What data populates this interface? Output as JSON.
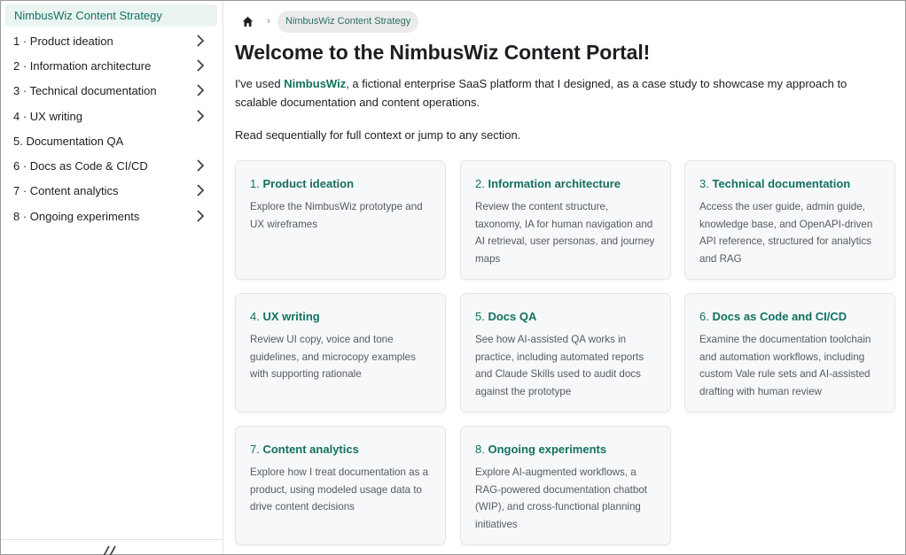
{
  "sidebar": {
    "active_label": "NimbusWiz Content Strategy",
    "items": [
      {
        "label": "1 · Product ideation"
      },
      {
        "label": "2 · Information architecture"
      },
      {
        "label": "3 · Technical documentation"
      },
      {
        "label": "4 · UX writing"
      },
      {
        "label": "5. Documentation QA"
      },
      {
        "label": "6 · Docs as Code & CI/CD"
      },
      {
        "label": "7 · Content analytics"
      },
      {
        "label": "8 · Ongoing experiments"
      }
    ],
    "collapse_icon": "double-chevron-left-icon"
  },
  "breadcrumb": {
    "home_icon": "home-icon",
    "separator": "›",
    "current": "NimbusWiz Content Strategy"
  },
  "page": {
    "title": "Welcome to the NimbusWiz Content Portal!",
    "intro_prefix": "I've used ",
    "intro_brand": "NimbusWiz",
    "intro_suffix": ", a fictional enterprise SaaS platform that I designed, as a case study to showcase my approach to scalable documentation and content operations.",
    "read_note": "Read sequentially for full context or jump to any section."
  },
  "cards": [
    {
      "num": "1.",
      "title": "Product ideation",
      "desc": "Explore the NimbusWiz prototype and UX wireframes"
    },
    {
      "num": "2.",
      "title": "Information architecture",
      "desc": "Review the content structure, taxonomy, IA for human navigation and AI retrieval, user personas, and journey maps"
    },
    {
      "num": "3.",
      "title": "Technical documentation",
      "desc": "Access the user guide, admin guide, knowledge base, and OpenAPI-driven API reference, structured for analytics and RAG"
    },
    {
      "num": "4.",
      "title": "UX writing",
      "desc": "Review UI copy, voice and tone guidelines, and microcopy examples with supporting rationale"
    },
    {
      "num": "5.",
      "title": "Docs QA",
      "desc": "See how AI-assisted QA works in practice, including automated reports and Claude Skills used to audit docs against the prototype"
    },
    {
      "num": "6.",
      "title": "Docs as Code and CI/CD",
      "desc": "Examine the documentation toolchain and automation workflows, including custom Vale rule sets and AI-assisted drafting with human review"
    },
    {
      "num": "7.",
      "title": "Content analytics",
      "desc": "Explore how I treat documentation as a product, using modeled usage data to drive content decisions"
    },
    {
      "num": "8.",
      "title": "Ongoing experiments",
      "desc": "Explore AI-augmented workflows, a RAG-powered documentation chatbot (WIP), and cross-functional planning initiatives"
    }
  ],
  "colors": {
    "accent": "#13705f",
    "active_bg": "#eaf4f1",
    "card_bg": "#f6f8fa"
  }
}
